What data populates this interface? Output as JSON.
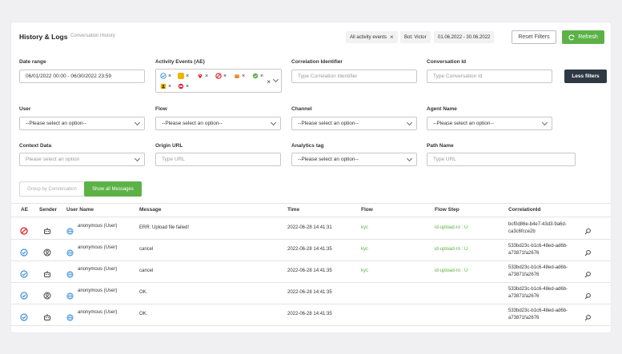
{
  "header": {
    "title": "History & Logs",
    "subtitle": "Conversation History",
    "chips": [
      {
        "label": "All activity events",
        "has_close": true
      },
      {
        "label": "Bot: Victor",
        "has_close": false
      },
      {
        "label": "01.06.2022 - 30.06.2022",
        "has_close": false
      }
    ],
    "reset_label": "Reset Filters",
    "refresh_label": "Refresh"
  },
  "filters": {
    "date_range": {
      "label": "Date range",
      "value": "06/01/2022 00:00 - 06/30/2022 23:59"
    },
    "activity_events": {
      "label": "Activity Events (AE)",
      "icons": [
        "check-circle-icon",
        "chat-icon",
        "location-pin-icon",
        "forbidden-icon",
        "robot-icon",
        "thumbs-up-icon",
        "person-icon",
        "alert-icon"
      ]
    },
    "correlation": {
      "label": "Correlation Identifier",
      "placeholder": "Type Correlation Identifier"
    },
    "conversation_id": {
      "label": "Conversation Id",
      "placeholder": "Type Conversation Id"
    },
    "less_filters_label": "Less filters",
    "user": {
      "label": "User",
      "value": "--Please select an option--"
    },
    "flow": {
      "label": "Flow",
      "value": "--Please select an option--"
    },
    "channel": {
      "label": "Channel",
      "value": "--Please select an option--"
    },
    "agent_name": {
      "label": "Agent Name",
      "value": "--Please select an option--"
    },
    "context_data": {
      "label": "Context Data",
      "placeholder": "Please select an option"
    },
    "origin_url": {
      "label": "Origin URL",
      "placeholder": "Type URL"
    },
    "analytics_tag": {
      "label": "Analytics tag",
      "value": "--Please select an option--"
    },
    "path_name": {
      "label": "Path Name",
      "placeholder": "Type URL"
    }
  },
  "view_toggle": {
    "group": "Group by Conversation",
    "show_all": "Show all Messages"
  },
  "table": {
    "columns": [
      "AE",
      "Sender",
      "User Name",
      "Message",
      "Time",
      "Flow",
      "Flow Step",
      "CorrelationId"
    ],
    "rows": [
      {
        "ae": "forbidden-icon",
        "sender": "robot-icon",
        "user": "anonymous (User)",
        "message": "ERR: Upload file failed!",
        "time": "2022-06-28 14:41:31",
        "flow": "kyc",
        "flow_step": "id-upload-ro : U",
        "corr1": "bcf0d86e-b4e7-43d3-9a6d-",
        "corr2": "ca3c6fcce2b"
      },
      {
        "ae": "check-circle-icon",
        "sender": "user-icon",
        "user": "anonymous (User)",
        "message": "cancel",
        "time": "2022-06-28 14:41:35",
        "flow": "kyc",
        "flow_step": "id-upload-ro : U",
        "corr1": "533bd23c-b1c6-48ed-ad6b-",
        "corr2": "a73871fa2676"
      },
      {
        "ae": "check-circle-icon",
        "sender": "robot-icon",
        "user": "anonymous (User)",
        "message": "cancel",
        "time": "2022-06-28 14:41:35",
        "flow": "kyc",
        "flow_step": "id-upload-ro : U",
        "corr1": "533bd23c-b1c6-48ed-ad6b-",
        "corr2": "a73871fa2676"
      },
      {
        "ae": "check-circle-icon",
        "sender": "user-icon",
        "user": "anonymous (User)",
        "message": "OK.",
        "time": "2022-06-28 14:41:35",
        "flow": "",
        "flow_step": "",
        "corr1": "533bd23c-b1c6-48ed-ad6b-",
        "corr2": "a73871fa2676"
      },
      {
        "ae": "check-circle-icon",
        "sender": "robot-icon",
        "user": "anonymous (User)",
        "message": "OK.",
        "time": "2022-06-28 14:41:35",
        "flow": "",
        "flow_step": "",
        "corr1": "533bd23c-b1c6-48ed-ad6b-",
        "corr2": "a73871fa2676"
      }
    ]
  },
  "colors": {
    "accent_green": "#5cb247",
    "dark_button": "#2f3944",
    "ae_blue": "#3a8fd8",
    "ae_red": "#d9232e"
  }
}
